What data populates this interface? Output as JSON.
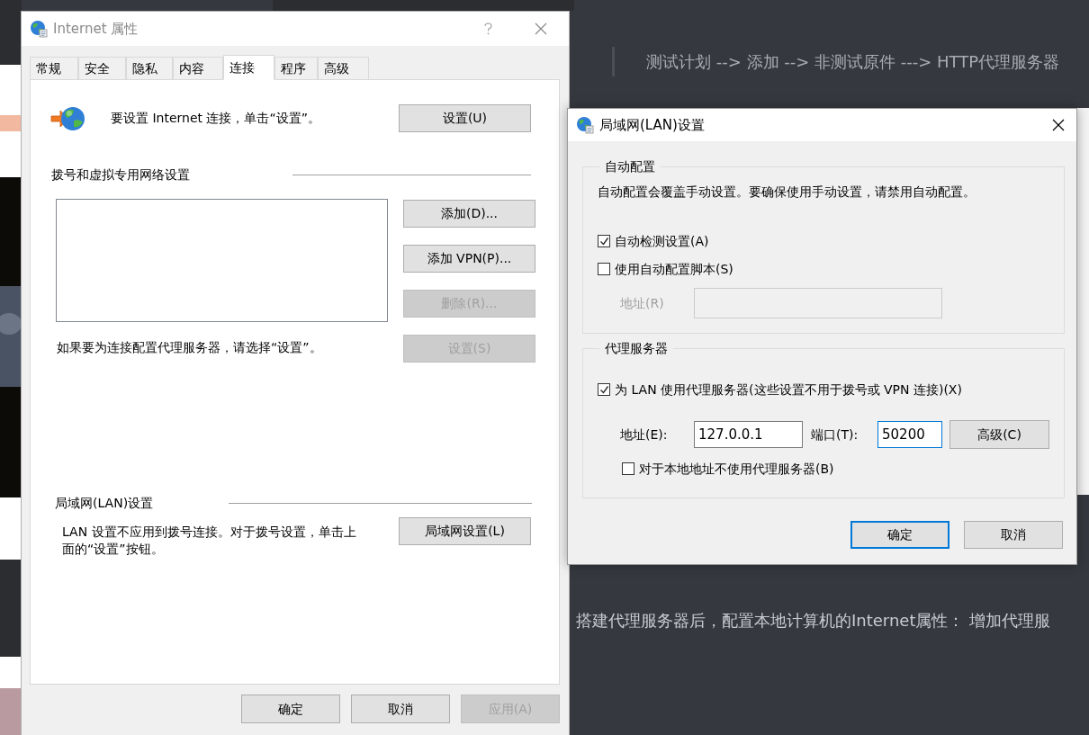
{
  "background_page": {
    "quote": "测试计划 --> 添加 --> 非测试原件 ---> HTTP代理服务器",
    "paragraph": "搭建代理服务器后，配置本地计算机的Internet属性： 增加代理服"
  },
  "internet_options": {
    "title": "Internet 属性",
    "active": false,
    "tabs": [
      {
        "label": "常规",
        "selected": false
      },
      {
        "label": "安全",
        "selected": false
      },
      {
        "label": "隐私",
        "selected": false
      },
      {
        "label": "内容",
        "selected": false
      },
      {
        "label": "连接",
        "selected": true
      },
      {
        "label": "程序",
        "selected": false
      },
      {
        "label": "高级",
        "selected": false
      }
    ],
    "setup_prompt": "要设置 Internet 连接，单击“设置”。",
    "setup_button": {
      "label": "设置(U)",
      "disabled": false
    },
    "dialup_section": {
      "heading": "拨号和虚拟专用网络设置",
      "buttons": [
        {
          "label": "添加(D)...",
          "disabled": false
        },
        {
          "label": "添加 VPN(P)...",
          "disabled": false
        },
        {
          "label": "删除(R)...",
          "disabled": true
        },
        {
          "label": "设置(S)",
          "disabled": true
        }
      ],
      "hint": "如果要为连接配置代理服务器，请选择“设置”。"
    },
    "lan_section": {
      "heading": "局域网(LAN)设置",
      "note": "LAN 设置不应用到拨号连接。对于拨号设置，单击上面的“设置”按钮。",
      "button": {
        "label": "局域网设置(L)",
        "disabled": false
      }
    },
    "footer_buttons": [
      {
        "label": "确定",
        "disabled": false
      },
      {
        "label": "取消",
        "disabled": false
      },
      {
        "label": "应用(A)",
        "disabled": true
      }
    ]
  },
  "lan_settings": {
    "title": "局域网(LAN)设置",
    "active": true,
    "auto_config": {
      "legend": "自动配置",
      "description": "自动配置会覆盖手动设置。要确保使用手动设置，请禁用自动配置。",
      "options": [
        {
          "label": "自动检测设置(A)",
          "checked": true
        },
        {
          "label": "使用自动配置脚本(S)",
          "checked": false
        }
      ],
      "address": {
        "label": "地址(R)",
        "disabled": true
      }
    },
    "proxy": {
      "legend": "代理服务器",
      "use_proxy": {
        "label": "为 LAN 使用代理服务器(这些设置不用于拨号或 VPN 连接)(X)",
        "checked": true
      },
      "address": {
        "label": "地址(E):",
        "value": "127.0.0.1",
        "focused": false
      },
      "port": {
        "label": "端口(T):",
        "value": "50200",
        "focused": true
      },
      "advanced_button": {
        "label": "高级(C)",
        "disabled": false
      },
      "bypass_local": {
        "label": "对于本地地址不使用代理服务器(B)",
        "checked": false
      }
    },
    "buttons": [
      {
        "label": "确定",
        "default": true
      },
      {
        "label": "取消",
        "default": false
      }
    ]
  }
}
